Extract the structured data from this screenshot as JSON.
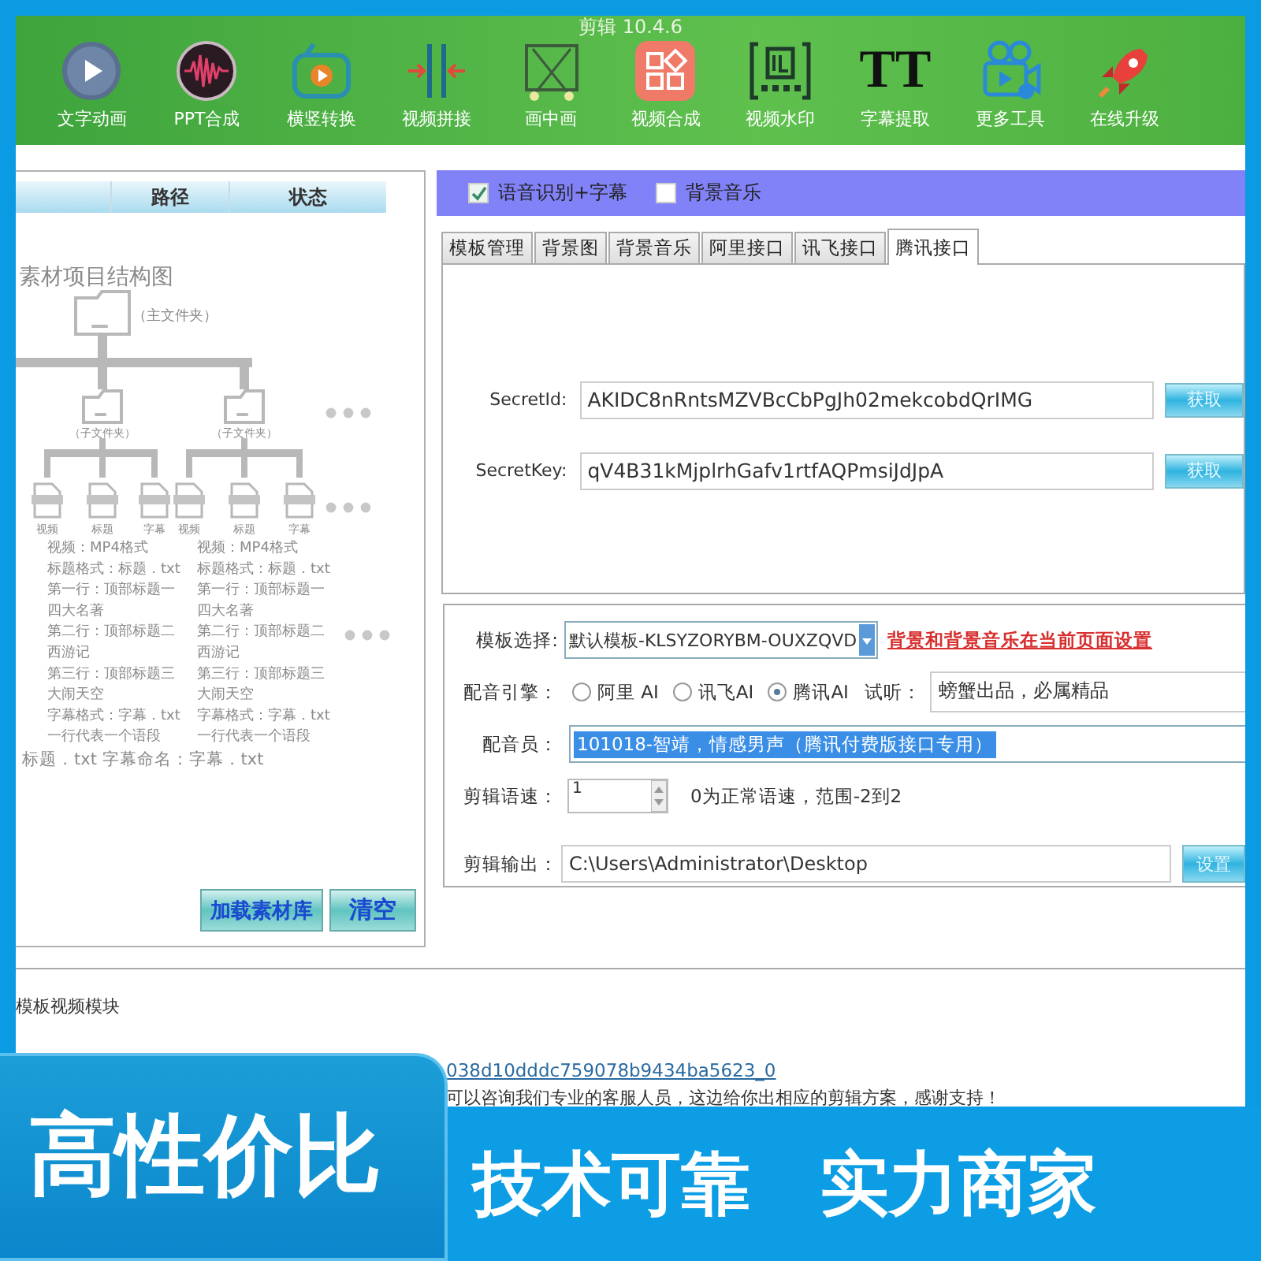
{
  "window": {
    "title": "剪辑 10.4.6"
  },
  "toolbar": [
    {
      "label": "文字动画"
    },
    {
      "label": "PPT合成"
    },
    {
      "label": "横竖转换"
    },
    {
      "label": "视频拼接"
    },
    {
      "label": "画中画"
    },
    {
      "label": "视频合成"
    },
    {
      "label": "视频水印"
    },
    {
      "label": "字幕提取",
      "glyph": "TT"
    },
    {
      "label": "更多工具"
    },
    {
      "label": "在线升级"
    }
  ],
  "file_table": {
    "columns": [
      "路径",
      "状态"
    ]
  },
  "structure_diagram": {
    "title": "素材项目结构图",
    "main_folder": "（主文件夹）",
    "sub_folders": [
      "（子文件夹）",
      "（子文件夹）"
    ],
    "file_labels": [
      "视频",
      "标题",
      "字幕",
      "视频",
      "标题",
      "字幕"
    ],
    "notes": [
      [
        "视频：MP4格式",
        "标题格式：标题．txt",
        "第一行：顶部标题一",
        "四大名著",
        "第二行：顶部标题二",
        "西游记",
        "第三行：顶部标题三",
        "大闹天空",
        "字幕格式：字幕．txt",
        "一行代表一个语段"
      ],
      [
        "视频：MP4格式",
        "标题格式：标题．txt",
        "第一行：顶部标题一",
        "四大名著",
        "第二行：顶部标题二",
        "西游记",
        "第三行：顶部标题三",
        "大闹天空",
        "字幕格式：字幕．txt",
        "一行代表一个语段"
      ]
    ],
    "footer": "标题．txt 字幕命名：字幕．txt"
  },
  "library_buttons": [
    "加载素材库",
    "清空"
  ],
  "options": [
    {
      "label": "语音识别+字幕",
      "checked": true
    },
    {
      "label": "背景音乐",
      "checked": false
    }
  ],
  "tabs": [
    {
      "label": "模板管理",
      "selected": false
    },
    {
      "label": "背景图",
      "selected": false
    },
    {
      "label": "背景音乐",
      "selected": false
    },
    {
      "label": "阿里接口",
      "selected": false
    },
    {
      "label": "讯飞接口",
      "selected": false
    },
    {
      "label": "腾讯接口",
      "selected": true
    }
  ],
  "credentials": [
    {
      "label": "SecretId:",
      "value": "AKIDC8nRntsMZVBcCbPgJh02mekcobdQrIMG",
      "button": "获取"
    },
    {
      "label": "SecretKey:",
      "value": "qV4B31kMjplrhGafv1rtfAQPmsiJdJpA",
      "button": "获取"
    }
  ],
  "settings": {
    "template_label": "模板选择:",
    "template_value": "默认模板-KLSYZORYBM-OUXZQVD",
    "template_note": "背景和背景音乐在当前页面设置",
    "engine_label": "配音引擎：",
    "engines": [
      {
        "label": "阿里 AI",
        "selected": false
      },
      {
        "label": "讯飞AI",
        "selected": false
      },
      {
        "label": "腾讯AI",
        "selected": true
      }
    ],
    "preview_label": "试听：",
    "preview_value": "螃蟹出品，必属精品",
    "voice_label": "配音员：",
    "voice_value": "101018-智靖，情感男声（腾讯付费版接口专用）",
    "voice_highlighted": true,
    "speed_label": "剪辑语速：",
    "speed_value": "1",
    "speed_hint": "0为正常语速，范围-2到2",
    "output_label": "剪辑输出：",
    "output_value": "C:\\Users\\Administrator\\Desktop",
    "output_button": "设置"
  },
  "log": {
    "module": "模板视频模块",
    "link": "038d10dddc759078b9434ba5623_0",
    "message": "可以咨询我们专业的客服人员，这边给你出相应的剪辑方案，感谢支持！"
  },
  "banner": {
    "badge": "高性价比",
    "slogans": [
      "技术可靠",
      "实力商家"
    ]
  }
}
